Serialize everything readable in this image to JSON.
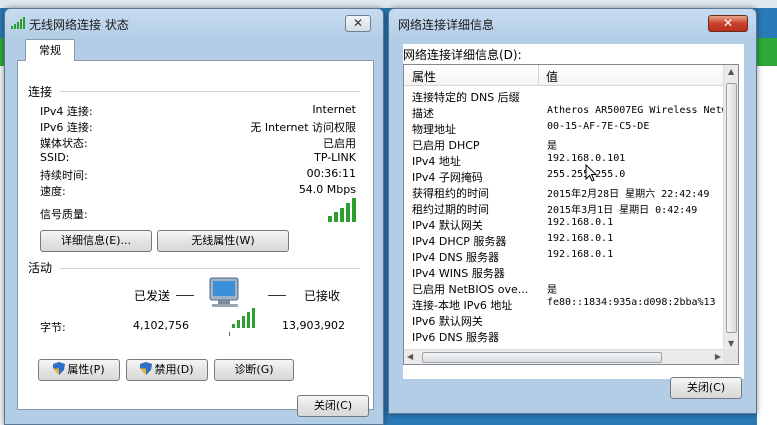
{
  "status_window": {
    "title": "无线网络连接 状态",
    "close_glyph": "✕",
    "tab": "常规",
    "connection": {
      "label": "连接",
      "rows": [
        {
          "key": "IPv4 连接:",
          "value": "Internet"
        },
        {
          "key": "IPv6 连接:",
          "value": "无 Internet 访问权限"
        },
        {
          "key": "媒体状态:",
          "value": "已启用"
        },
        {
          "key": "SSID:",
          "value": "TP-LINK"
        },
        {
          "key": "持续时间:",
          "value": "00:36:11"
        },
        {
          "key": "速度:",
          "value": "54.0 Mbps"
        }
      ],
      "signal_label": "信号质量:",
      "details_button": "详细信息(E)...",
      "wireless_props_button": "无线属性(W)"
    },
    "activity": {
      "label": "活动",
      "sent_label": "已发送",
      "received_label": "已接收",
      "bytes_label": "字节:",
      "bytes_sent": "4,102,756",
      "bytes_received": "13,903,902"
    },
    "buttons": {
      "properties": "属性(P)",
      "disable": "禁用(D)",
      "diagnose": "诊断(G)",
      "close": "关闭(C)"
    }
  },
  "details_window": {
    "title": "网络连接详细信息",
    "close_glyph": "✕",
    "list_label": "网络连接详细信息(D):",
    "col_property": "属性",
    "col_value": "值",
    "rows": [
      {
        "property": "连接特定的 DNS 后缀",
        "value": ""
      },
      {
        "property": "描述",
        "value": "Atheros AR5007EG Wireless Netw"
      },
      {
        "property": "物理地址",
        "value": "00-15-AF-7E-C5-DE"
      },
      {
        "property": "已启用 DHCP",
        "value": "是"
      },
      {
        "property": "IPv4 地址",
        "value": "192.168.0.101"
      },
      {
        "property": "IPv4 子网掩码",
        "value": "255.255.255.0"
      },
      {
        "property": "获得租约的时间",
        "value": "2015年2月28日 星期六 22:42:49"
      },
      {
        "property": "租约过期的时间",
        "value": "2015年3月1日 星期日 0:42:49"
      },
      {
        "property": "IPv4 默认网关",
        "value": "192.168.0.1"
      },
      {
        "property": "IPv4 DHCP 服务器",
        "value": "192.168.0.1"
      },
      {
        "property": "IPv4 DNS 服务器",
        "value": "192.168.0.1"
      },
      {
        "property": "IPv4 WINS 服务器",
        "value": ""
      },
      {
        "property": "已启用 NetBIOS ove...",
        "value": "是"
      },
      {
        "property": "连接-本地 IPv6 地址",
        "value": "fe80::1834:935a:d098:2bba%13"
      },
      {
        "property": "IPv6 默认网关",
        "value": ""
      },
      {
        "property": "IPv6 DNS 服务器",
        "value": ""
      }
    ],
    "close_button": "关闭(C)"
  },
  "colors": {
    "signal_green": "#2e9e2e",
    "titlebar": "#b3cde6"
  }
}
